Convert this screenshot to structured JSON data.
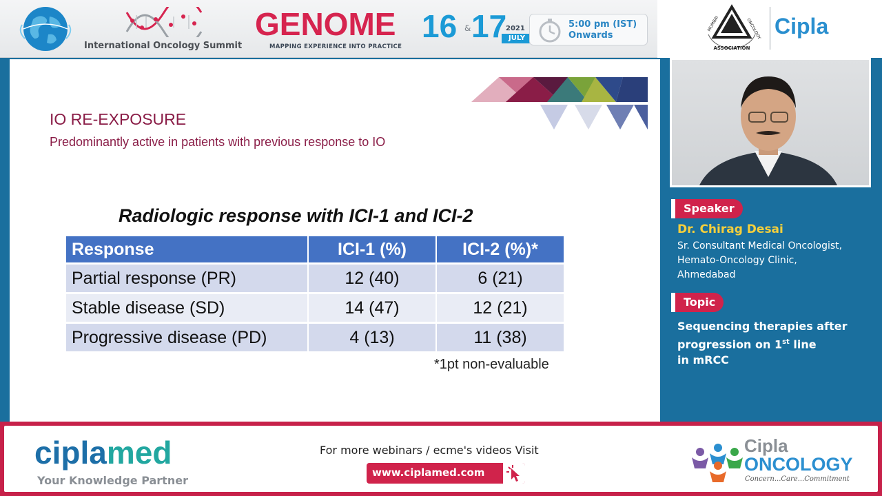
{
  "header": {
    "summit_label": "International Oncology Summit",
    "event_title": "GENOME",
    "event_subtitle": "MAPPING EXPERIENCE INTO PRACTICE",
    "date_day1": "16",
    "date_amp": "&",
    "date_day2": "17",
    "date_year": "2021",
    "date_month": "JULY",
    "time_line1": "5:00 pm (IST)",
    "time_line2": "Onwards",
    "association_logo_text": "MUMBAI ONCOLOGY ASSOCIATION",
    "sponsor": "Cipla"
  },
  "slide": {
    "title": "IO RE-EXPOSURE",
    "subtitle": "Predominantly active in patients with previous response to IO",
    "table_title": "Radiologic response with ICI-1 and ICI-2",
    "headers": [
      "Response",
      "ICI-1 (%)",
      "ICI-2 (%)*"
    ],
    "rows": [
      [
        "Partial response (PR)",
        "12 (40)",
        "6 (21)"
      ],
      [
        "Stable disease (SD)",
        "14 (47)",
        "12 (21)"
      ],
      [
        "Progressive disease (PD)",
        "4 (13)",
        "11 (38)"
      ]
    ],
    "footnote": "*1pt non-evaluable"
  },
  "speaker_panel": {
    "speaker_label": "Speaker",
    "name": "Dr. Chirag Desai",
    "desc_line1": "Sr. Consultant Medical Oncologist,",
    "desc_line2": "Hemato-Oncology Clinic,",
    "desc_line3": "Ahmedabad",
    "topic_label": "Topic",
    "topic_line1": "Sequencing therapies after",
    "topic_line2a": "progression on 1",
    "topic_line2_sup": "st",
    "topic_line2b": " line",
    "topic_line3": "in mRCC"
  },
  "footer": {
    "brand_part1": "cipla",
    "brand_part2": "med",
    "brand_tagline": "Your Knowledge Partner",
    "webinar_text": "For more webinars / ecme's videos Visit",
    "url": "www.ciplamed.com",
    "onco_brand_top": "Cipla",
    "onco_brand_word": "ONCOLOGY",
    "onco_tagline": "Concern...Care...Commitment"
  },
  "colors": {
    "accent_red": "#d0234b",
    "panel_blue": "#1a6f9e",
    "table_header_blue": "#4472c4",
    "title_maroon": "#8a1d47",
    "speaker_name_yellow": "#f5cf3c"
  }
}
